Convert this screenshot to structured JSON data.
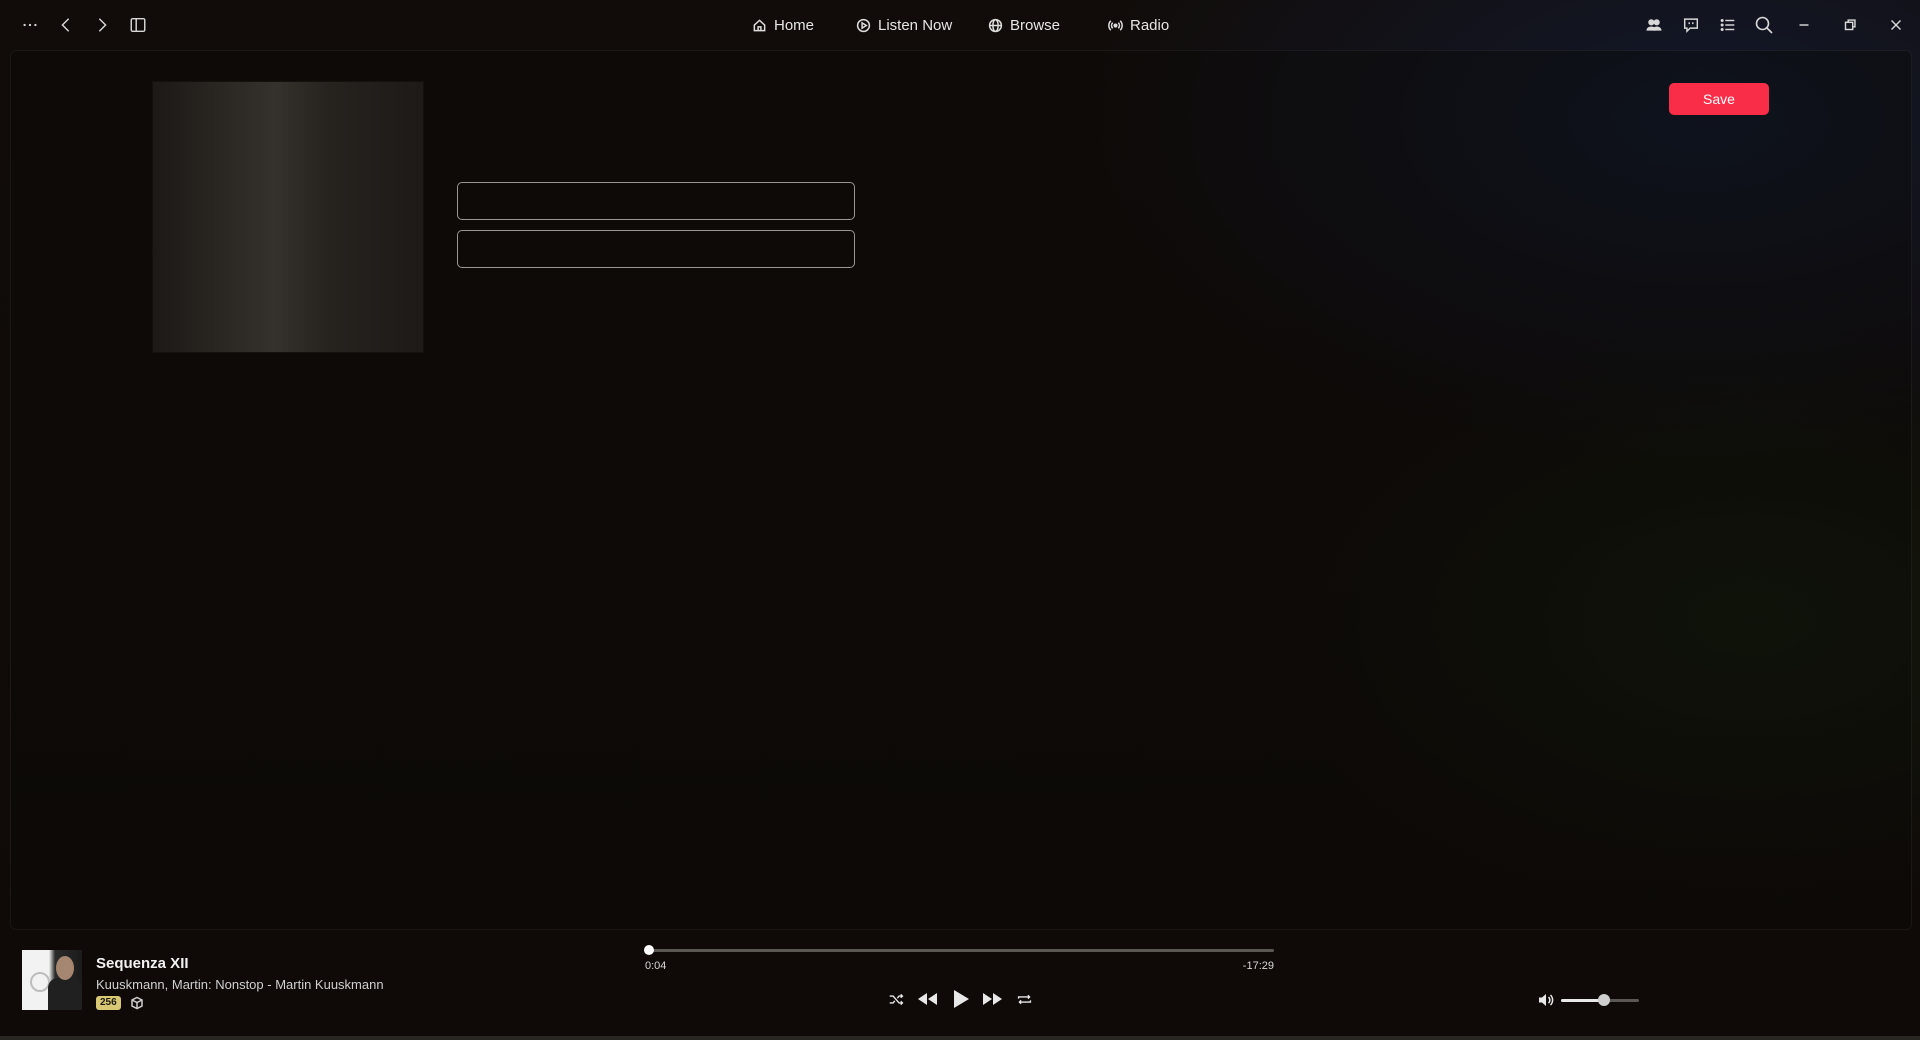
{
  "nav": {
    "items": [
      {
        "label": "Home",
        "icon": "home-icon"
      },
      {
        "label": "Listen Now",
        "icon": "play-circle-icon"
      },
      {
        "label": "Browse",
        "icon": "globe-icon"
      },
      {
        "label": "Radio",
        "icon": "radio-icon"
      }
    ]
  },
  "titlebar": {
    "left_icons": [
      "more-icon",
      "back-icon",
      "forward-icon",
      "sidebar-toggle-icon"
    ],
    "right_icons": [
      "friends-icon",
      "lyrics-icon",
      "queue-icon",
      "search-icon",
      "minimize-icon",
      "restore-icon",
      "close-icon"
    ]
  },
  "editor": {
    "field1_value": "",
    "field2_value": "",
    "save_label": "Save"
  },
  "player": {
    "title": "Sequenza XII",
    "subtitle": "Kuuskmann, Martin: Nonstop - Martin Kuuskmann",
    "badge": "256",
    "elapsed": "0:04",
    "remaining": "-17:29",
    "progress": 0.005,
    "volume": 0.55
  },
  "colors": {
    "accent": "#fa2d48",
    "badge": "#d8c874"
  }
}
